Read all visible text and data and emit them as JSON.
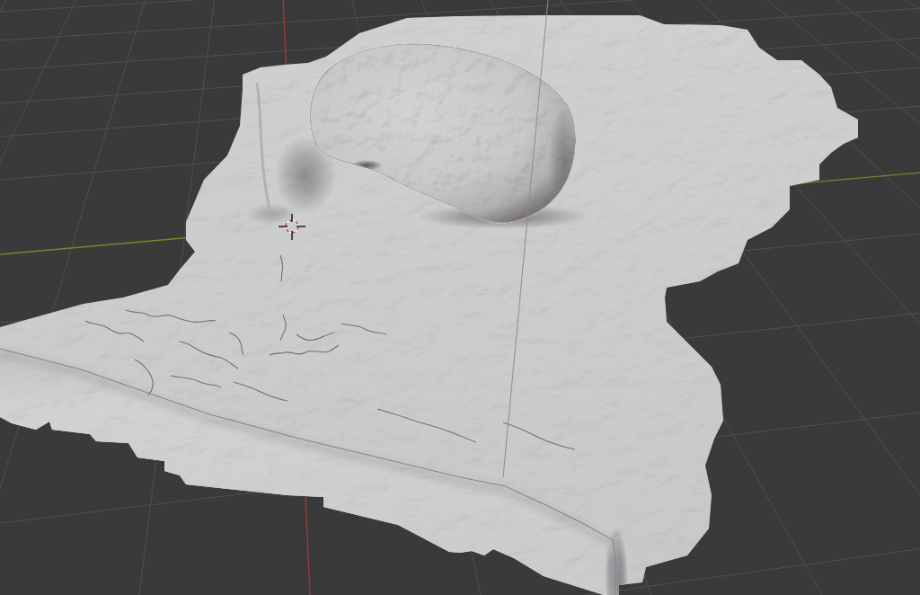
{
  "viewport": {
    "grid": true,
    "cursor": true,
    "axes": [
      {
        "kind": "x",
        "color": "#a5383c"
      },
      {
        "kind": "y",
        "color": "#6c8a2b"
      }
    ]
  }
}
